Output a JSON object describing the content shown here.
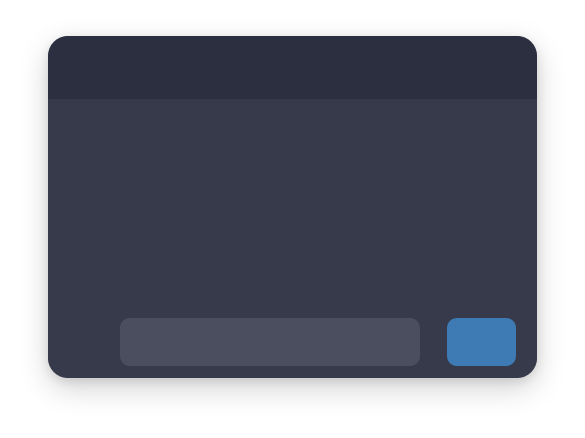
{
  "window": {
    "title": ""
  },
  "composer": {
    "input_value": "",
    "input_placeholder": "",
    "send_label": ""
  },
  "colors": {
    "window_background": "#363a4b",
    "titlebar_background": "#2b2f3f",
    "input_background": "#4a4e5f",
    "accent": "#3e7bb4"
  }
}
